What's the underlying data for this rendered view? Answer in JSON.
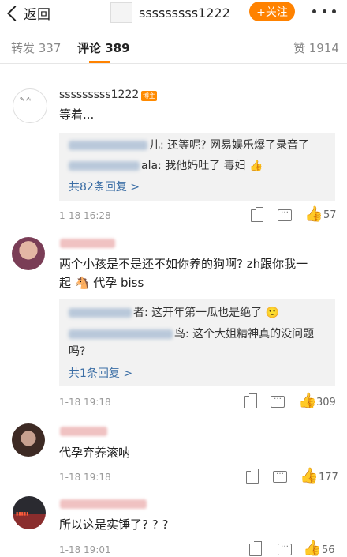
{
  "nav": {
    "back_label": "返回",
    "username": "sssssssss1222",
    "follow_label": "+关注"
  },
  "tabs": {
    "repost": "转发 337",
    "comment": "评论 389",
    "like": "赞 1914"
  },
  "comments": [
    {
      "name": "sssssssss1222",
      "badge": "博主",
      "text": "等着...",
      "replies": [
        "儿: 还等呢? 网易娱乐爆了录音了",
        "ala: 我他妈吐了 毒妇 👍"
      ],
      "more": "共82条回复 >",
      "time": "1-18 16:28",
      "likes": "57"
    },
    {
      "text1": "两个小孩是不是还不如你养的狗啊? zh跟你我一",
      "text2": "起 🐴 代孕 biss",
      "replies": [
        "者: 这开年第一瓜也是绝了 🙂",
        "鸟: 这个大姐精神真的没问题",
        "吗?"
      ],
      "more": "共1条回复 >",
      "time": "1-18 19:18",
      "likes": "309"
    },
    {
      "text": "代孕弃养滚呐",
      "time": "1-18 19:18",
      "likes": "177"
    },
    {
      "text": "所以这是实锤了? ? ?",
      "time": "1-18 19:01",
      "likes": "56"
    }
  ],
  "colors": {
    "accent": "#ff8200",
    "link": "#3b6ea5"
  }
}
